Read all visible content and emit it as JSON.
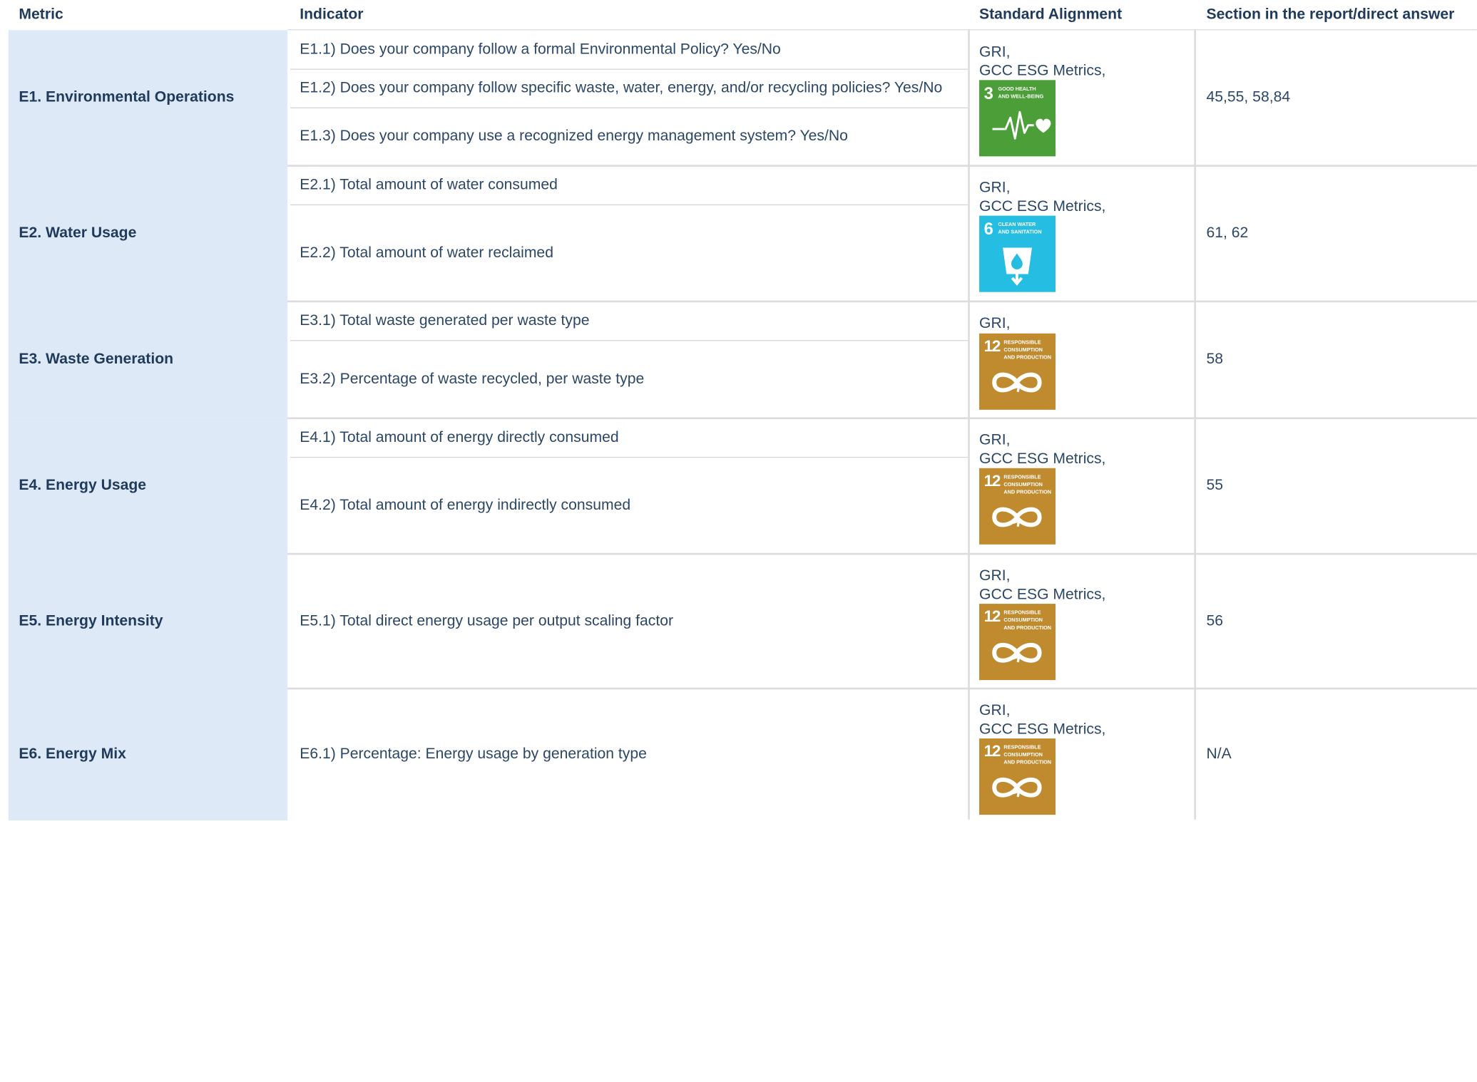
{
  "headers": {
    "metric": "Metric",
    "indicator": "Indicator",
    "standard": "Standard Alignment",
    "section": "Section in the report/direct answer"
  },
  "rows": [
    {
      "metric": "E1. Environmental Operations",
      "indicators": [
        "E1.1) Does your company follow a formal Environmental Policy? Yes/No",
        "E1.2) Does your company follow specific waste, water, energy, and/or recycling policies? Yes/No",
        "E1.3) Does your company use a recognized energy management system? Yes/No"
      ],
      "standard": "GRI,\nGCC ESG Metrics,",
      "section": "45,55, 58,84",
      "sdg": {
        "number": "3",
        "caption": "GOOD HEALTH\nAND WELL-BEING",
        "color": "#4c9f38",
        "icon": "heartbeat-icon"
      }
    },
    {
      "metric": "E2. Water Usage",
      "indicators": [
        "E2.1) Total amount of water consumed",
        "E2.2) Total amount of water reclaimed"
      ],
      "standard": "GRI,\nGCC ESG Metrics,",
      "section": "61, 62",
      "sdg": {
        "number": "6",
        "caption": "CLEAN WATER\nAND SANITATION",
        "color": "#26bde2",
        "icon": "water-glass-icon"
      }
    },
    {
      "metric": "E3. Waste Generation",
      "indicators": [
        "E3.1) Total waste generated per waste type",
        "E3.2) Percentage of waste recycled, per waste type"
      ],
      "standard": "GRI,",
      "section": "58",
      "sdg": {
        "number": "12",
        "caption": "RESPONSIBLE\nCONSUMPTION\nAND PRODUCTION",
        "color": "#bf8b2e",
        "icon": "infinity-icon"
      }
    },
    {
      "metric": "E4. Energy Usage",
      "indicators": [
        "E4.1) Total amount of energy directly consumed",
        "E4.2) Total amount of energy indirectly consumed"
      ],
      "standard": "GRI,\nGCC ESG Metrics,",
      "section": "55",
      "sdg": {
        "number": "12",
        "caption": "RESPONSIBLE\nCONSUMPTION\nAND PRODUCTION",
        "color": "#bf8b2e",
        "icon": "infinity-icon"
      }
    },
    {
      "metric": "E5. Energy Intensity",
      "indicators": [
        "E5.1) Total direct energy usage per output scaling factor"
      ],
      "standard": "GRI,\nGCC ESG Metrics,",
      "section": "56",
      "sdg": {
        "number": "12",
        "caption": "RESPONSIBLE\nCONSUMPTION\nAND PRODUCTION",
        "color": "#bf8b2e",
        "icon": "infinity-icon"
      }
    },
    {
      "metric": "E6. Energy Mix",
      "indicators": [
        "E6.1) Percentage: Energy usage by generation type"
      ],
      "standard": "GRI,\nGCC ESG Metrics,",
      "section": "N/A",
      "sdg": {
        "number": "12",
        "caption": "RESPONSIBLE\nCONSUMPTION\nAND PRODUCTION",
        "color": "#bf8b2e",
        "icon": "infinity-icon"
      }
    }
  ]
}
